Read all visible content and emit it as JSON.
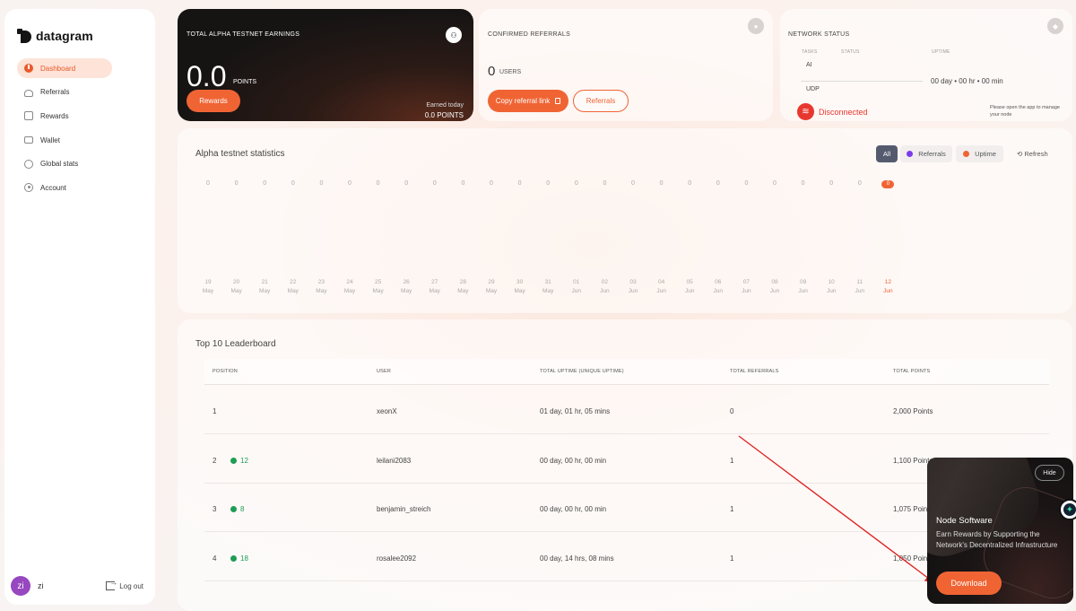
{
  "brand": {
    "name": "datagram"
  },
  "colors": {
    "accent": "#f06434",
    "danger": "#e8372f",
    "positive": "#1f9d55"
  },
  "sidebar": {
    "items": [
      {
        "label": "Dashboard",
        "icon": "dashboard-icon",
        "active": true
      },
      {
        "label": "Referrals",
        "icon": "people-icon"
      },
      {
        "label": "Rewards",
        "icon": "rewards-icon"
      },
      {
        "label": "Wallet",
        "icon": "wallet-icon"
      },
      {
        "label": "Global stats",
        "icon": "globe-icon"
      },
      {
        "label": "Account",
        "icon": "account-icon"
      }
    ],
    "user": {
      "initials": "zi",
      "name": "zi"
    },
    "logout_label": "Log out"
  },
  "earnings": {
    "caption": "TOTAL ALPHA TESTNET EARNINGS",
    "value": "0.0",
    "unit": "POINTS",
    "rewards_button": "Rewards",
    "earned_today_label": "Earned today",
    "earned_today_value": "0.0 POINTS"
  },
  "referrals": {
    "caption": "CONFIRMED REFERRALS",
    "count": "0",
    "unit": "USERS",
    "copy_button": "Copy referral link",
    "referrals_button": "Referrals"
  },
  "network": {
    "caption": "NETWORK STATUS",
    "col_tasks": "TASKS",
    "col_status": "STATUS",
    "col_uptime": "UPTIME",
    "task_1": "AI",
    "task_2": "UDP",
    "uptime": "00 day • 00 hr • 00 min",
    "status": "Disconnected",
    "hint": "Please open the app to manage your node"
  },
  "stats": {
    "title": "Alpha testnet statistics",
    "filters": {
      "all": "All",
      "referrals": "Referrals",
      "uptime": "Uptime"
    },
    "referrals_color": "#7c3aed",
    "uptime_color": "#f06434",
    "refresh_label": "Refresh"
  },
  "chart_data": {
    "type": "bar",
    "categories": [
      "19 May",
      "20 May",
      "21 May",
      "22 May",
      "23 May",
      "24 May",
      "25 May",
      "26 May",
      "27 May",
      "28 May",
      "29 May",
      "30 May",
      "31 May",
      "01 Jun",
      "02 Jun",
      "03 Jun",
      "04 Jun",
      "05 Jun",
      "06 Jun",
      "07 Jun",
      "08 Jun",
      "09 Jun",
      "10 Jun",
      "11 Jun",
      "12 Jun"
    ],
    "values": [
      0,
      0,
      0,
      0,
      0,
      0,
      0,
      0,
      0,
      0,
      0,
      0,
      0,
      0,
      0,
      0,
      0,
      0,
      0,
      0,
      0,
      0,
      0,
      0,
      0
    ],
    "highlighted_index": 24
  },
  "leaderboard": {
    "title": "Top 10 Leaderboard",
    "headers": [
      "POSITION",
      "USER",
      "TOTAL UPTIME (UNIQUE UPTIME)",
      "TOTAL REFERRALS",
      "TOTAL POINTS"
    ],
    "rows": [
      {
        "position": "1",
        "change": "",
        "user": "xeonX",
        "uptime": "01 day, 01 hr, 05 mins",
        "referrals": "0",
        "points": "2,000 Points"
      },
      {
        "position": "2",
        "change": "12",
        "user": "leilani2083",
        "uptime": "00 day, 00 hr, 00 min",
        "referrals": "1",
        "points": "1,100 Points"
      },
      {
        "position": "3",
        "change": "8",
        "user": "benjamin_streich",
        "uptime": "00 day, 00 hr, 00 min",
        "referrals": "1",
        "points": "1,075 Points"
      },
      {
        "position": "4",
        "change": "18",
        "user": "rosalee2092",
        "uptime": "00 day, 14 hrs, 08 mins",
        "referrals": "1",
        "points": "1,050 Points"
      }
    ]
  },
  "popup": {
    "hide_label": "Hide",
    "title": "Node Software",
    "description": "Earn Rewards by Supporting the Network's Decentralized Infrastructure",
    "download_label": "Download"
  }
}
